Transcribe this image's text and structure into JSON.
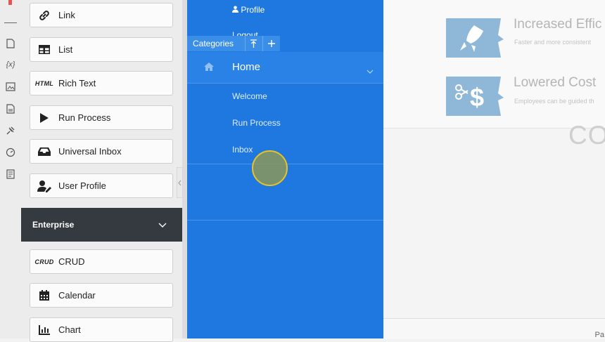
{
  "palette": {
    "items": [
      {
        "label": "Link",
        "icon": "link-icon"
      },
      {
        "label": "List",
        "icon": "table-icon"
      },
      {
        "label": "Rich Text",
        "icon": "html-icon",
        "icon_text": "HTML"
      },
      {
        "label": "Run Process",
        "icon": "play-icon"
      },
      {
        "label": "Universal Inbox",
        "icon": "inbox-icon"
      },
      {
        "label": "User Profile",
        "icon": "user-edit-icon"
      }
    ],
    "section_title": "Enterprise",
    "enterprise_items": [
      {
        "label": "CRUD",
        "icon": "crud-icon",
        "icon_text": "CRUD"
      },
      {
        "label": "Calendar",
        "icon": "calendar-icon"
      },
      {
        "label": "Chart",
        "icon": "chart-icon"
      }
    ]
  },
  "menu": {
    "profile": "Profile",
    "logout": "Logout",
    "categories_label": "Categories",
    "home": "Home",
    "sub_items": [
      "Welcome",
      "Run Process",
      "Inbox"
    ]
  },
  "content": {
    "feature1_title": "Increased Effic",
    "feature1_sub": "Faster and more consistent",
    "feature2_title": "Lowered Cost",
    "feature2_sub": "Employees can be guided th",
    "big_text": "CO",
    "footer_text": "Pa"
  },
  "colors": {
    "menu_bg": "#1e78e0",
    "section_bg": "#343a40",
    "feature_icon": "#8fb8d8"
  }
}
